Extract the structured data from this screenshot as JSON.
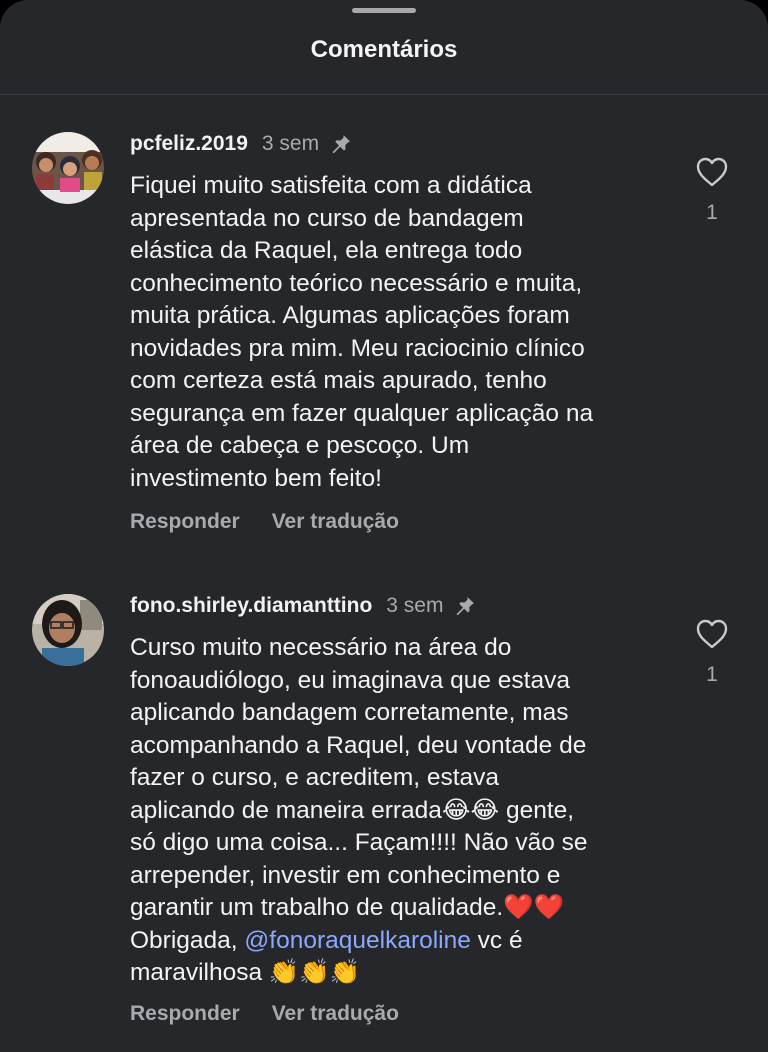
{
  "header": {
    "title": "Comentários"
  },
  "comments": [
    {
      "username": "pcfeliz.2019",
      "time": "3 sem",
      "pinned_icon": "pin-icon",
      "lines": [
        "Fiquei muito satisfeita com a didática",
        "apresentada no curso de bandagem",
        "elástica da Raquel, ela entrega todo",
        "conhecimento teórico necessário e muita,",
        "muita prática. Algumas aplicações foram",
        "novidades pra mim. Meu raciocinio clínico",
        "com certeza está mais apurado, tenho",
        "segurança em fazer qualquer aplicação na",
        "área de cabeça e pescoço. Um",
        "investimento bem feito!"
      ],
      "likes": "1",
      "reply_label": "Responder",
      "translate_label": "Ver tradução"
    },
    {
      "username": "fono.shirley.diamanttino",
      "time": "3 sem",
      "pinned_icon": "pin-icon",
      "lines": [
        "Curso muito necessário na área do",
        "fonoaudiólogo, eu imaginava que estava",
        "aplicando bandagem corretamente, mas",
        "acompanhando a Raquel, deu vontade de",
        "fazer o curso, e acreditem, estava",
        "aplicando de maneira errada😂😂 gente,",
        "só digo uma coisa... Façam!!!! Não vão se",
        "arrepender, investir em conhecimento e",
        "garantir um trabalho de qualidade.❤️❤️"
      ],
      "line_before_mention": "Obrigada, ",
      "mention": "@fonoraquelkaroline",
      "line_after_mention": " vc é",
      "last_line": "maravilhosa 👏👏👏",
      "likes": "1",
      "reply_label": "Responder",
      "translate_label": "Ver tradução"
    }
  ],
  "colors": {
    "background": "#26272b",
    "text": "#f3f3f3",
    "secondary": "#a9aaae",
    "mention": "#8aa9ff"
  }
}
